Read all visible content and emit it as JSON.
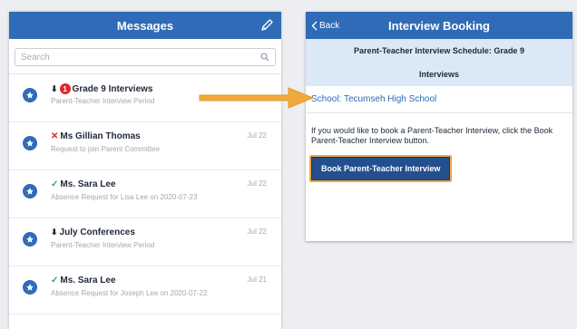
{
  "messages_panel": {
    "title": "Messages",
    "search_placeholder": "Search",
    "items": [
      {
        "status": "down",
        "badge": "1",
        "title": "Grade 9 Interviews",
        "subtitle": "Parent-Teacher Interview Period",
        "date": ""
      },
      {
        "status": "x",
        "badge": "",
        "title": "Ms Gillian Thomas",
        "subtitle": "Request to join Parent Committee",
        "date": "Jul 22"
      },
      {
        "status": "check",
        "badge": "",
        "title": "Ms. Sara Lee",
        "subtitle": "Absence Request for Lisa Lee on 2020-07-23",
        "date": "Jul 22"
      },
      {
        "status": "down",
        "badge": "",
        "title": "July Conferences",
        "subtitle": "Parent-Teacher Interview Period",
        "date": "Jul 22"
      },
      {
        "status": "check",
        "badge": "",
        "title": "Ms. Sara Lee",
        "subtitle": "Absence Request for Joseph Lee on 2020-07-22",
        "date": "Jul 21"
      }
    ]
  },
  "booking_panel": {
    "back_label": "Back",
    "title": "Interview Booking",
    "schedule_line1": "Parent-Teacher Interview Schedule: Grade 9",
    "schedule_line2": "Interviews",
    "school": "School: Tecumseh High School",
    "instructions": "If you would like to book a Parent-Teacher Interview, click the Book Parent-Teacher Interview button.",
    "book_button": "Book Parent-Teacher Interview"
  },
  "colors": {
    "header_blue": "#2f6bb6",
    "button_blue": "#244f8f",
    "highlight_orange": "#f2a93b",
    "badge_red": "#e0262b",
    "check_green": "#3aa552"
  }
}
